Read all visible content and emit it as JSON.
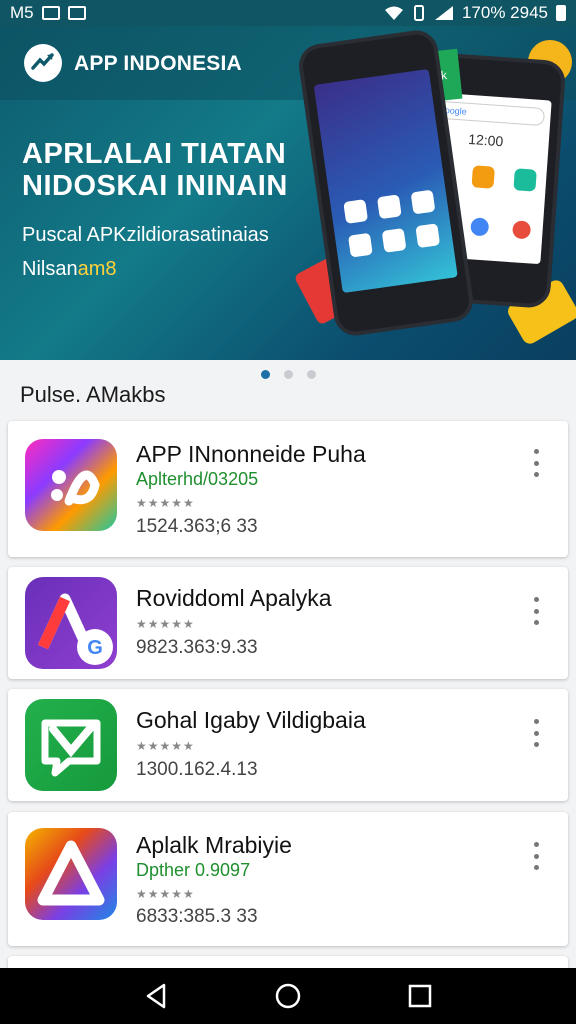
{
  "status_bar": {
    "left_text": "M5",
    "right_text": "170% 2945",
    "icons": [
      "image-icon",
      "notification-icon",
      "wifi-icon",
      "vibrate-icon",
      "signal-icon",
      "battery-icon"
    ]
  },
  "banner": {
    "brand": "APP INDONESIA",
    "title_line1": "APRLALAI TIATAN",
    "title_line2": "NIDOSKAI ININAIN",
    "subtitle": "Puscal APKzildiorasatinaias",
    "subtitle2_prefix": "Nilsan",
    "subtitle2_highlight": "am8",
    "phone_text": "Bereok",
    "phone_search": "Google",
    "phone_clock": "12:00",
    "carousel_pages": 3,
    "carousel_active": 1
  },
  "section": {
    "title": "Pulse. AMakbs"
  },
  "apps": [
    {
      "name": "APP INnonneide Puha",
      "developer": "Aplterhd/03205",
      "rating": "★★★★★",
      "size": "1524.363;6 33",
      "icon": "colorful-swirl-icon"
    },
    {
      "name": "Roviddoml Apalyka",
      "developer": "",
      "rating": "★★★★★",
      "size": "9823.363:9.33",
      "icon": "purple-a-google-icon"
    },
    {
      "name": "Gohal Igaby Vildigbaia",
      "developer": "",
      "rating": "★★★★★",
      "size": "1300.162.4.13",
      "icon": "green-chat-icon"
    },
    {
      "name": "Aplalk Mrabiyie",
      "developer": "Dpther 0.9097",
      "rating": "★★★★★",
      "size": "6833:385.3 33",
      "icon": "rainbow-triangle-icon"
    }
  ],
  "colors": {
    "status_bar": "#0f5563",
    "banner_start": "#0d5c6e",
    "banner_end": "#0a3f60",
    "developer_green": "#1f8f2f",
    "dot_active": "#1d6fa5"
  },
  "nav": {
    "icons": [
      "back-icon",
      "home-icon",
      "recents-icon"
    ]
  }
}
